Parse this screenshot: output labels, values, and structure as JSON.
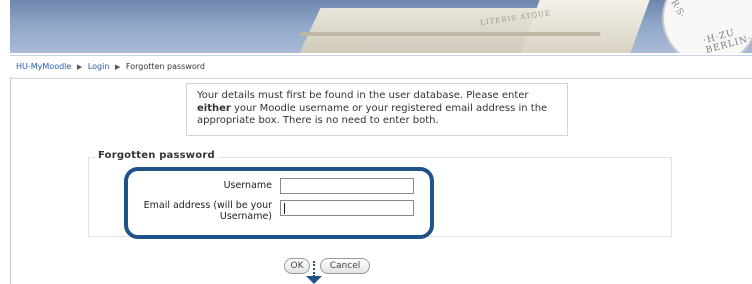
{
  "header": {
    "seal_text": "·H·ZU BERLIN·",
    "seal_text_top": "R·S·",
    "inscription": "LITERIS ATQUE"
  },
  "breadcrumb": {
    "home": "HU-MyMoodle",
    "login": "Login",
    "current": "Forgotten password",
    "separator": "▶"
  },
  "info": {
    "text_before": "Your details must first be found in the user database. Please enter",
    "emphasis": "either",
    "text_after": "your Moodle username or your registered email address in the appropriate box. There is no need to enter both."
  },
  "form": {
    "legend": "Forgotten password",
    "username_label": "Username",
    "username_value": "",
    "email_label_line1": "Email address (will be your",
    "email_label_line2": "Username)",
    "email_value": ""
  },
  "buttons": {
    "ok": "OK",
    "cancel": "Cancel"
  },
  "colors": {
    "highlight": "#1e5388",
    "link": "#2a5aa8"
  }
}
